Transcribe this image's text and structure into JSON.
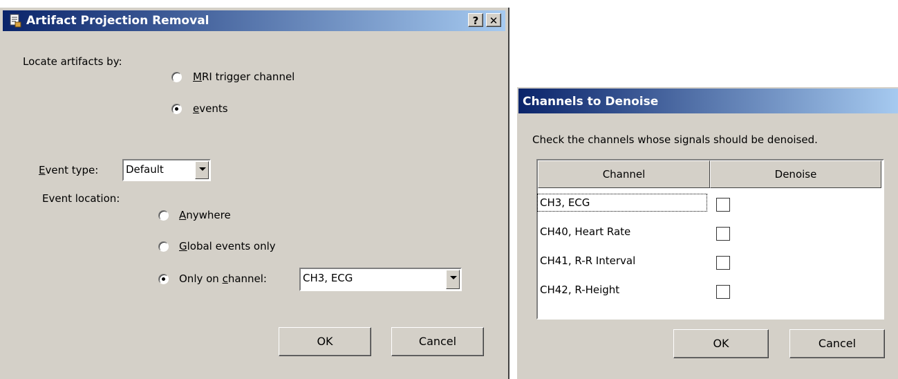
{
  "dialog1": {
    "title": "Artifact Projection Removal",
    "help_label": "?",
    "close_label": "✕",
    "locate_label": "Locate artifacts by:",
    "locate_options": [
      {
        "prefix": "",
        "mnemonic": "M",
        "rest": "RI trigger channel",
        "checked": false
      },
      {
        "prefix": "",
        "mnemonic": "e",
        "rest": "vents",
        "checked": true
      }
    ],
    "event_type_label": {
      "mnemonic": "E",
      "rest": "vent type:"
    },
    "event_type_value": "Default",
    "event_location_label": "Event location:",
    "location_options": [
      {
        "prefix": "",
        "mnemonic": "A",
        "rest": "nywhere",
        "checked": false
      },
      {
        "prefix": "",
        "mnemonic": "G",
        "rest": "lobal events only",
        "checked": false
      },
      {
        "prefix": "Only on ",
        "mnemonic": "c",
        "rest": "hannel:",
        "checked": true
      }
    ],
    "channel_value": "CH3, ECG",
    "ok_label": "OK",
    "cancel_label": "Cancel"
  },
  "dialog2": {
    "title": "Channels to Denoise",
    "instruction": "Check the channels whose signals should be denoised.",
    "columns": [
      "Channel",
      "Denoise"
    ],
    "rows": [
      {
        "channel": "CH3, ECG",
        "denoise": false
      },
      {
        "channel": "CH40, Heart Rate",
        "denoise": false
      },
      {
        "channel": "CH41, R-R Interval",
        "denoise": false
      },
      {
        "channel": "CH42, R-Height",
        "denoise": false
      }
    ],
    "ok_label": "OK",
    "cancel_label": "Cancel"
  },
  "colors": {
    "titlebar_start": "#0a246a",
    "titlebar_end": "#a6caf0",
    "face": "#d4d0c8"
  }
}
